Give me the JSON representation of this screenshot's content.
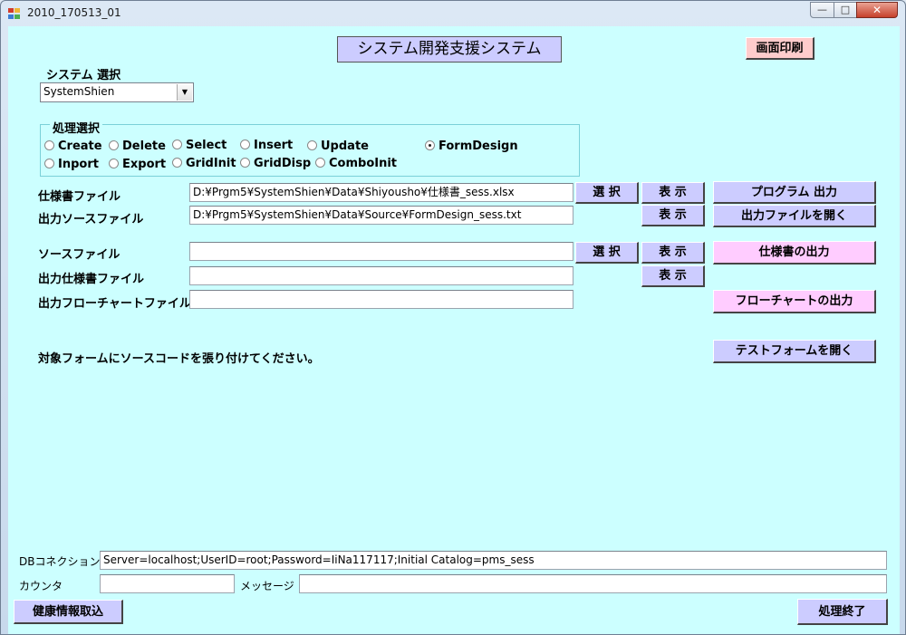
{
  "window": {
    "title": "2010_170513_01",
    "controls": {
      "minimize": "—",
      "maximize": "□",
      "close": "✕"
    }
  },
  "header": {
    "banner": "システム開発支援システム",
    "print_button": "画面印刷"
  },
  "system_select": {
    "label": "システム 選択",
    "value": "SystemShien"
  },
  "process_select": {
    "legend": "処理選択",
    "options": [
      "Create",
      "Delete",
      "Select",
      "Insert",
      "Update",
      "FormDesign",
      "Inport",
      "Export",
      "GridInit",
      "GridDisp",
      "ComboInit"
    ],
    "selected": "FormDesign"
  },
  "spec_file": {
    "label": "仕様書ファイル",
    "value": "D:¥Prgm5¥SystemShien¥Data¥Shiyousho¥仕様書_sess.xlsx"
  },
  "output_source_file": {
    "label": "出力ソースファイル",
    "value": "D:¥Prgm5¥SystemShien¥Data¥Source¥FormDesign_sess.txt"
  },
  "source_file": {
    "label": "ソースファイル",
    "value": ""
  },
  "output_spec_file": {
    "label": "出力仕様書ファイル",
    "value": ""
  },
  "output_flowchart_file": {
    "label": "出力フローチャートファイル",
    "value": ""
  },
  "buttons": {
    "select": "選 択",
    "show": "表 示",
    "program_output": "プログラム 出力",
    "open_output_file": "出力ファイルを開く",
    "spec_output": "仕様書の出力",
    "flowchart_output": "フローチャートの出力",
    "open_test_form": "テストフォームを開く",
    "health_import": "健康情報取込",
    "end_process": "処理終了"
  },
  "instruction": "対象フォームにソースコードを張り付けてください。",
  "footer": {
    "db_label": "DBコネクション",
    "db_value": "Server=localhost;UserID=root;Password=IiNa117117;Initial Catalog=pms_sess",
    "counter_label": "カウンタ",
    "counter_value": "",
    "message_label": "メッセージ",
    "message_value": ""
  },
  "colors": {
    "client_bg": "#ccffff",
    "violet_button": "#ccccff",
    "pink_button": "#ffccff",
    "print_button": "#ffcccc"
  },
  "icons": [
    "app-icon",
    "minimize-icon",
    "maximize-icon",
    "close-icon",
    "dropdown-arrow-icon",
    "radio-icon"
  ]
}
